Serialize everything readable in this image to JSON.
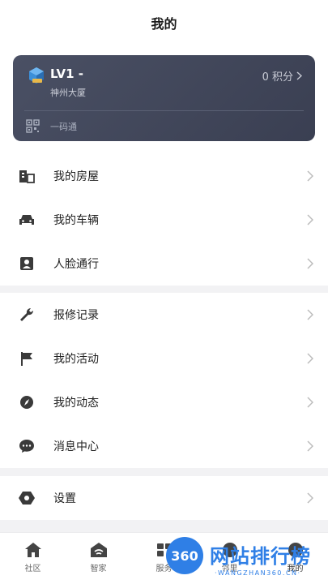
{
  "header": {
    "title": "我的"
  },
  "card": {
    "level": "LV1 -",
    "building": "神州大厦",
    "points": "0 积分",
    "qr_label": "一码通"
  },
  "groups": [
    {
      "items": [
        {
          "label": "我的房屋",
          "icon": "building-icon"
        },
        {
          "label": "我的车辆",
          "icon": "car-icon"
        },
        {
          "label": "人脸通行",
          "icon": "face-id-icon"
        }
      ]
    },
    {
      "items": [
        {
          "label": "报修记录",
          "icon": "wrench-icon"
        },
        {
          "label": "我的活动",
          "icon": "flag-icon"
        },
        {
          "label": "我的动态",
          "icon": "compass-icon"
        },
        {
          "label": "消息中心",
          "icon": "chat-icon"
        }
      ]
    },
    {
      "items": [
        {
          "label": "设置",
          "icon": "settings-icon"
        }
      ]
    }
  ],
  "tabs": [
    {
      "label": "社区",
      "icon": "home-icon"
    },
    {
      "label": "智家",
      "icon": "smart-home-icon"
    },
    {
      "label": "服务",
      "icon": "service-icon"
    },
    {
      "label": "邻里",
      "icon": "neighbor-icon"
    },
    {
      "label": "我的",
      "icon": "profile-icon",
      "active": true
    }
  ],
  "watermark": {
    "badge": "360",
    "text": "网站排行榜",
    "url": "·WANGZHAN360.CN·"
  },
  "colors": {
    "card_bg": "#3f4457",
    "accent": "#2f7fe6",
    "icon": "#3a3a3a"
  }
}
